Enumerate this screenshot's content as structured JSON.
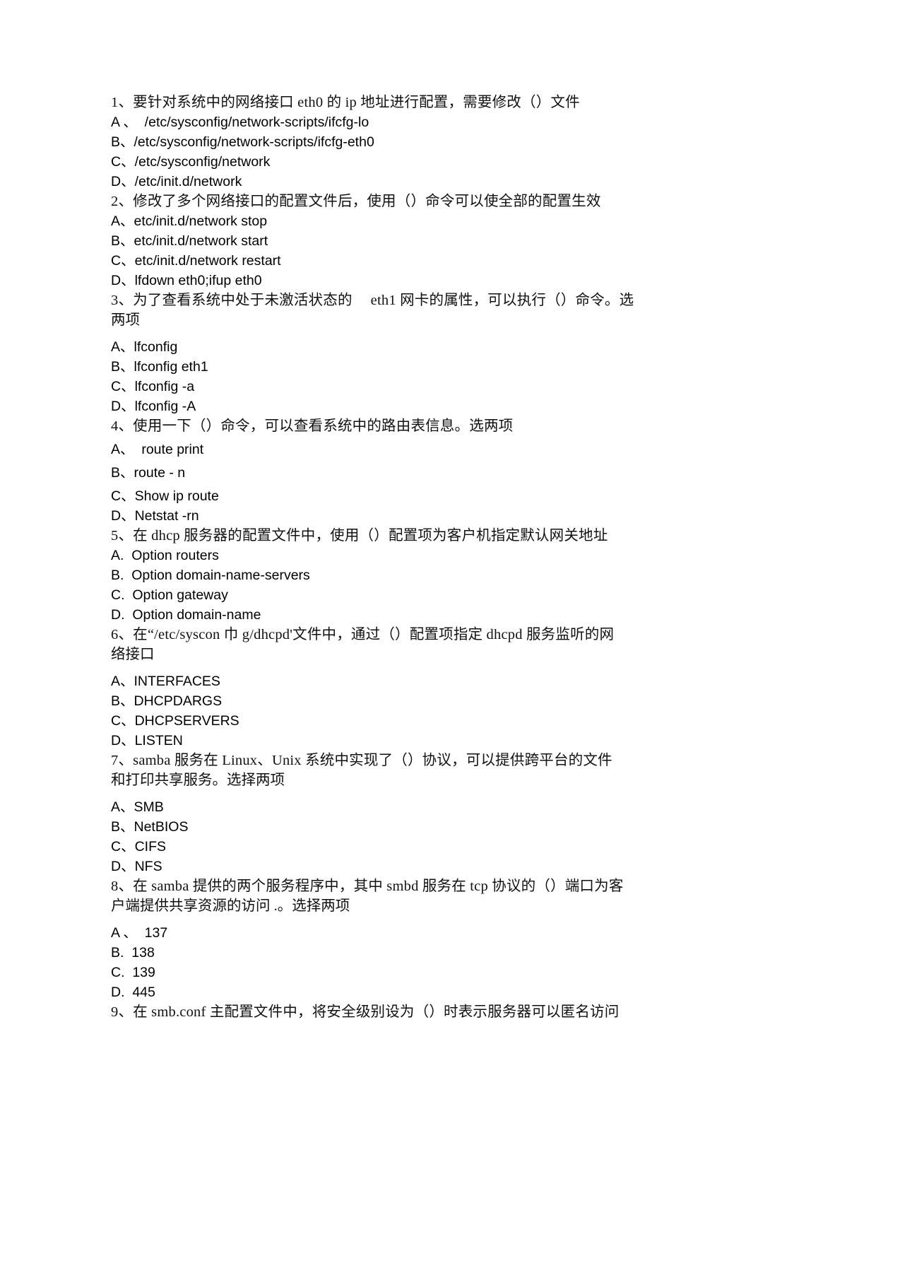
{
  "document": {
    "type": "scanned-exam-paper",
    "language": "zh-CN",
    "background_color": "#ffffff",
    "text_color": "#000000",
    "questions": [
      {
        "number": "1",
        "stem_line1": "1、要针对系统中的网络接口  eth0 的 ip 地址进行配置，需要修改（）文件",
        "stem_line2": "",
        "options": [
          "A 、  /etc/sysconfig/network-scripts/ifcfg-lo",
          "B、/etc/sysconfig/network-scripts/ifcfg-eth0",
          "C、/etc/sysconfig/network",
          "D、/etc/init.d/network"
        ]
      },
      {
        "number": "2",
        "stem_line1": "2、修改了多个网络接口的配置文件后，使用（）命令可以使全部的配置生效",
        "stem_line2": "",
        "options": [
          "A、etc/init.d/network stop",
          "B、etc/init.d/network start",
          "C、etc/init.d/network restart",
          "D、lfdown eth0;ifup eth0"
        ]
      },
      {
        "number": "3",
        "stem_line1": "3、为了查看系统中处于未激活状态的　 eth1 网卡的属性，可以执行（）命令。选",
        "stem_line2": "两项",
        "options": [
          "A、lfconfig",
          "B、lfconfig eth1",
          "C、lfconfig -a",
          "D、lfconfig -A"
        ]
      },
      {
        "number": "4",
        "stem_line1": "4、使用一下（）命令，可以查看系统中的路由表信息。选两项",
        "stem_line2": "",
        "options": [
          "A、  route print",
          "B、route - n",
          "C、Show ip route",
          "D、Netstat -rn"
        ]
      },
      {
        "number": "5",
        "stem_line1": "5、在 dhcp 服务器的配置文件中，使用（）配置项为客户机指定默认网关地址",
        "stem_line2": "",
        "options": [
          "A.  Option routers",
          "B.  Option domain-name-servers",
          "C.  Option gateway",
          "D.  Option domain-name"
        ]
      },
      {
        "number": "6",
        "stem_line1": "6、在“/etc/syscon 巾 g/dhcpd'文件中，通过（）配置项指定 dhcpd 服务监听的网",
        "stem_line2": "络接口",
        "options": [
          "A、INTERFACES",
          "B、DHCPDARGS",
          "C、DHCPSERVERS",
          "D、LISTEN"
        ]
      },
      {
        "number": "7",
        "stem_line1": "7、samba 服务在 Linux、Unix 系统中实现了（）协议，可以提供跨平台的文件",
        "stem_line2": "和打印共享服务。选择两项",
        "options": [
          "A、SMB",
          "B、NetBIOS",
          "C、CIFS",
          "D、NFS"
        ]
      },
      {
        "number": "8",
        "stem_line1": "8、在 samba 提供的两个服务程序中，其中 smbd 服务在 tcp 协议的（）端口为客",
        "stem_line2": "户端提供共享资源的访问 .。选择两项",
        "options": [
          "A 、  137",
          "B.  138",
          "C.  139",
          "D.  445"
        ]
      },
      {
        "number": "9",
        "stem_line1": "9、在 smb.conf 主配置文件中，将安全级别设为（）时表示服务器可以匿名访问",
        "stem_line2": "",
        "options": []
      }
    ]
  }
}
